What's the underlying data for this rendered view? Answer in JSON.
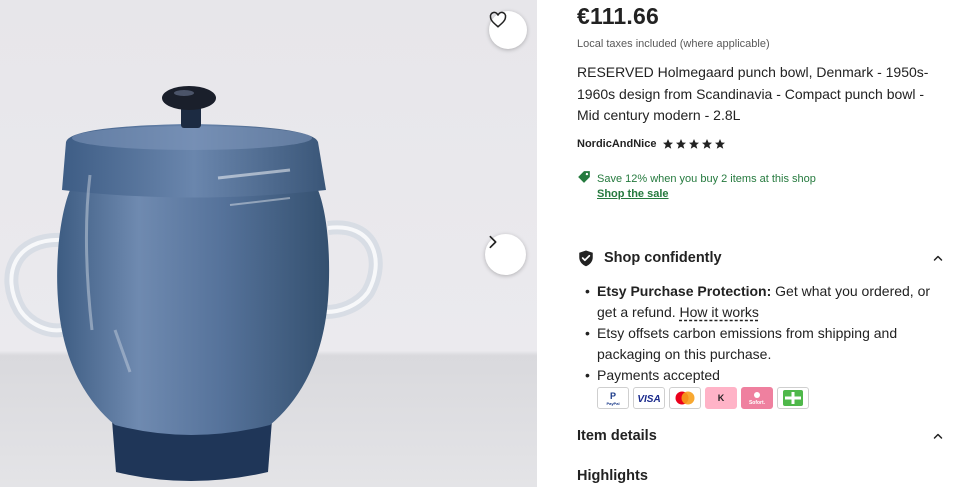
{
  "gallery": {
    "image_alt": "Blue glass punch bowl with lid",
    "favorite_icon": "heart-icon",
    "next_icon": "chevron-right-icon"
  },
  "listing": {
    "price": "€111.66",
    "taxes_note": "Local taxes included (where applicable)",
    "title": "RESERVED Holmegaard punch bowl, Denmark - 1950s-1960s design from Scandinavia - Compact punch bowl - Mid century modern - 2.8L",
    "shop_name": "NordicAndNice",
    "rating_stars": 5
  },
  "sale": {
    "icon": "tag-icon",
    "text": "Save 12% when you buy 2 items at this shop",
    "link": "Shop the sale",
    "color": "#257a3e"
  },
  "shop_confidently": {
    "title": "Shop confidently",
    "protection_label": "Etsy Purchase Protection:",
    "protection_text": " Get what you ordered, or get a refund. ",
    "how_it_works": "How it works",
    "carbon_text": "Etsy offsets carbon emissions from shipping and packaging on this purchase.",
    "payments_label": "Payments accepted",
    "payment_methods": [
      "PayPal",
      "VISA",
      "Mastercard",
      "Klarna",
      "Sofort",
      "Giropay"
    ]
  },
  "item_details": {
    "title": "Item details"
  },
  "highlights": {
    "title": "Highlights"
  }
}
